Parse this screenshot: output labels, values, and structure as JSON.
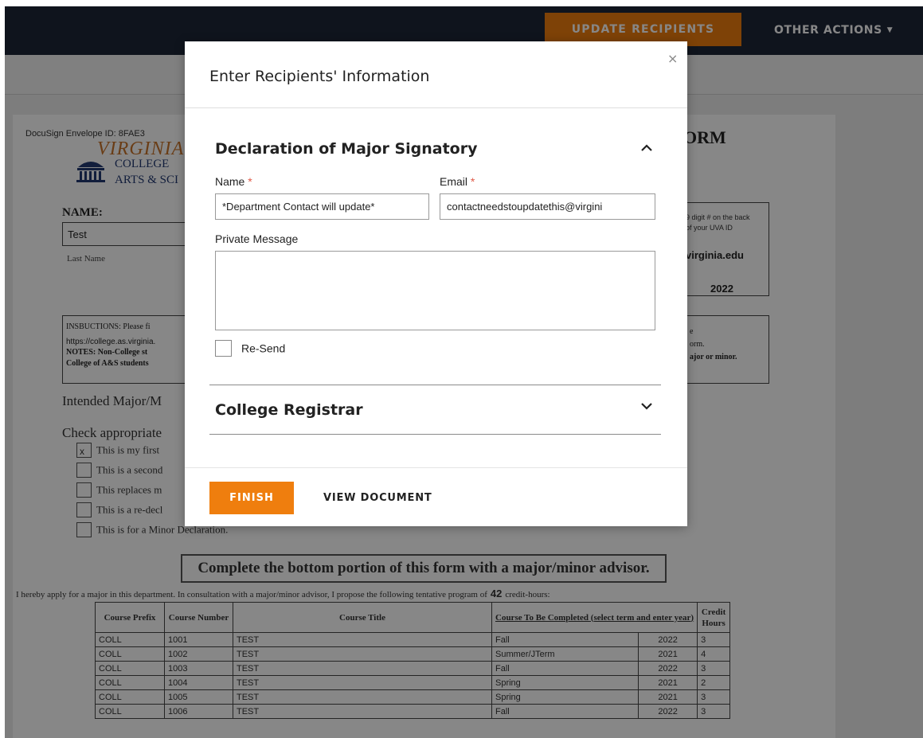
{
  "header": {
    "update_button": "UPDATE RECIPIENTS",
    "other_actions": "OTHER ACTIONS"
  },
  "document": {
    "envelope_id": "DocuSign Envelope ID: 8FAE3",
    "uva_word": "VIRGINIA",
    "college_line1": "COLLEGE",
    "college_line2": "ARTS & SCI",
    "form_title_partial": "ORM",
    "name_label": "NAME:",
    "name_value": "Test",
    "last_name_label": "Last Name",
    "id_note_line1": "9 digit # on the back",
    "id_note_line2": "of your UVA ID",
    "email_partial": "virginia.edu",
    "year": "2022",
    "instructions_line1": "INSBUCTIONS: Please fi",
    "instructions_line2": "https://college.as.virginia.",
    "instructions_line3": "NOTES:  Non-College st",
    "instructions_line4": "College of A&S students",
    "instructions_right1": "e",
    "instructions_right2": "orm.",
    "instructions_right3": "ajor or minor.",
    "intended_label": "Intended Major/M",
    "check_label": "Check appropriate",
    "checkboxes": [
      {
        "label": "This is my first",
        "checked": true
      },
      {
        "label": "This is a second",
        "checked": false
      },
      {
        "label": "This replaces m",
        "checked": false
      },
      {
        "label": "This is a re-decl",
        "checked": false
      },
      {
        "label": "This is for a Minor Declaration.",
        "checked": false
      }
    ],
    "check_mark": "x",
    "complete_banner": "Complete the bottom portion of this form with a major/minor advisor.",
    "apply_text_before": "I hereby apply for a major in this department. In consultation with a major/minor advisor, I propose the following tentative program of",
    "credit_hours_total": "42",
    "apply_text_after": "credit-hours:",
    "table": {
      "headers": {
        "prefix": "Course Prefix",
        "number": "Course Number",
        "title": "Course Title",
        "term_year": "Course To Be Completed (select term and enter year)",
        "credit": "Credit Hours"
      },
      "rows": [
        {
          "prefix": "COLL",
          "number": "1001",
          "title": "TEST",
          "term": "Fall",
          "year": "2022",
          "credit": "3"
        },
        {
          "prefix": "COLL",
          "number": "1002",
          "title": "TEST",
          "term": "Summer/JTerm",
          "year": "2021",
          "credit": "4"
        },
        {
          "prefix": "COLL",
          "number": "1003",
          "title": "TEST",
          "term": "Fall",
          "year": "2022",
          "credit": "3"
        },
        {
          "prefix": "COLL",
          "number": "1004",
          "title": "TEST",
          "term": "Spring",
          "year": "2021",
          "credit": "2"
        },
        {
          "prefix": "COLL",
          "number": "1005",
          "title": "TEST",
          "term": "Spring",
          "year": "2021",
          "credit": "3"
        },
        {
          "prefix": "COLL",
          "number": "1006",
          "title": "TEST",
          "term": "Fall",
          "year": "2022",
          "credit": "3"
        }
      ]
    }
  },
  "modal": {
    "close_icon": "×",
    "title": "Enter Recipients' Information",
    "section1": {
      "title": "Declaration of Major Signatory",
      "name_label": "Name",
      "email_label": "Email",
      "required_mark": "*",
      "name_value": "*Department Contact will update*",
      "email_value": "contactneedstoupdatethis@virgini",
      "message_label": "Private Message",
      "message_value": "",
      "resend_label": "Re-Send"
    },
    "section2": {
      "title": "College Registrar"
    },
    "finish_button": "FINISH",
    "view_button": "VIEW DOCUMENT"
  },
  "colors": {
    "accent_orange": "#ef7e0e",
    "header_navy": "#1e2637",
    "required_red": "#e05a48"
  },
  "icons": [
    "close-icon",
    "chevron-up-icon",
    "chevron-down-icon",
    "caret-down-icon",
    "rotunda-logo-icon",
    "checkbox-icon"
  ]
}
